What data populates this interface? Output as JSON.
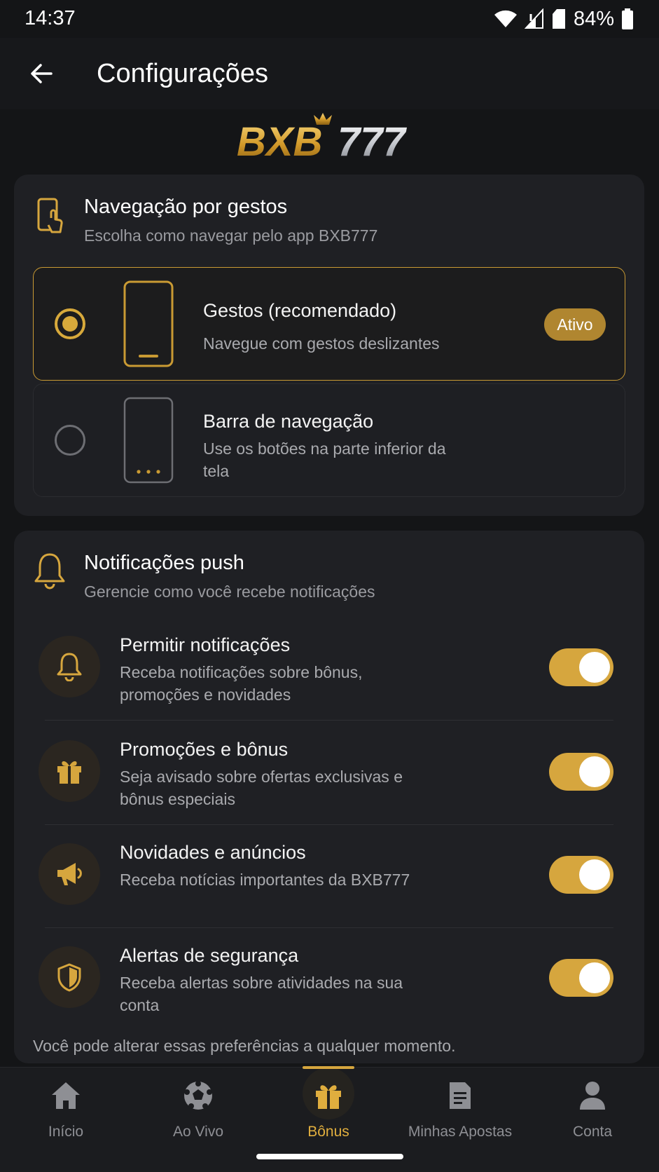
{
  "status_bar": {
    "time": "14:37",
    "battery": "84%",
    "icons": [
      "wifi-icon",
      "signal-icon",
      "sim-icon",
      "battery-icon"
    ]
  },
  "app_bar": {
    "title": "Configurações",
    "back_icon": "arrow-left-icon"
  },
  "brand": {
    "logo_text_gold": "BXB",
    "logo_text_silver": "777",
    "accent_color": "#d6a63e"
  },
  "gestures": {
    "title": "Navegação por gestos",
    "subtitle": "Escolha como navegar pelo app BXB777",
    "options": [
      {
        "title": "Gestos (recomendado)",
        "description": "Navegue com gestos deslizantes",
        "badge": "Ativo",
        "selected": true
      },
      {
        "title": "Barra de navegação",
        "description": "Use os botões na parte inferior da tela",
        "selected": false
      }
    ]
  },
  "push": {
    "title": "Notificações push",
    "subtitle": "Gerencie como você recebe notificações",
    "settings": [
      {
        "title": "Permitir notificações",
        "description": "Receba notificações sobre bônus, promoções e novidades",
        "icon": "bell-icon",
        "enabled": true
      },
      {
        "title": "Promoções e bônus",
        "description": "Seja avisado sobre ofertas exclusivas e bônus especiais",
        "icon": "gift-icon",
        "enabled": true
      },
      {
        "title": "Novidades e anúncios",
        "description": "Receba notícias importantes da BXB777",
        "icon": "megaphone-icon",
        "enabled": true
      },
      {
        "title": "Alertas de segurança",
        "description": "Receba alertas sobre atividades na sua conta",
        "icon": "shield-icon",
        "enabled": true
      }
    ],
    "footer_note": "Você pode alterar essas preferências a qualquer momento."
  },
  "bottom_nav": {
    "items": [
      {
        "label": "Início",
        "icon": "home-icon",
        "active": false
      },
      {
        "label": "Ao Vivo",
        "icon": "soccer-ball-icon",
        "active": false
      },
      {
        "label": "Bônus",
        "icon": "gift-icon",
        "active": true
      },
      {
        "label": "Minhas Apostas",
        "icon": "document-icon",
        "active": false
      },
      {
        "label": "Conta",
        "icon": "person-icon",
        "active": false
      }
    ]
  }
}
